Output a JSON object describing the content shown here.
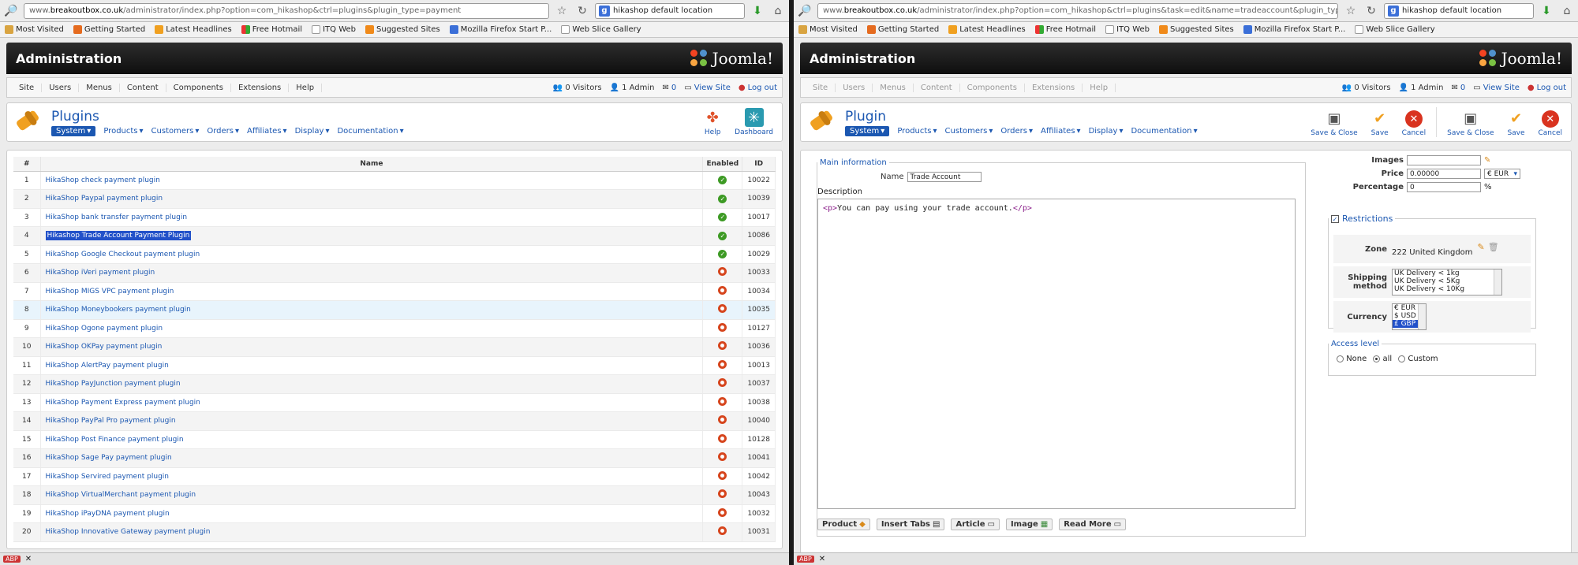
{
  "left": {
    "url_prefix": "www.",
    "url_host": "breakoutbox.co.uk",
    "url_path": "/administrator/index.php?option=com_hikashop&ctrl=plugins&plugin_type=payment",
    "search_text": "hikashop default location",
    "bookmarks": [
      "Most Visited",
      "Getting Started",
      "Latest Headlines",
      "Free Hotmail",
      "ITQ Web",
      "Suggested Sites",
      "Mozilla Firefox Start P...",
      "Web Slice Gallery"
    ],
    "admin_title": "Administration",
    "joomla_text": "Joomla!",
    "menu": [
      "Site",
      "Users",
      "Menus",
      "Content",
      "Components",
      "Extensions",
      "Help"
    ],
    "status": {
      "visitors": "0 Visitors",
      "admin": "1 Admin",
      "messages": "0",
      "view_site": "View Site",
      "logout": "Log out"
    },
    "page_title": "Plugins",
    "submenu": [
      "System",
      "Products",
      "Customers",
      "Orders",
      "Affiliates",
      "Display",
      "Documentation"
    ],
    "toolbar": {
      "help": "Help",
      "dashboard": "Dashboard"
    },
    "columns": {
      "num": "#",
      "name": "Name",
      "enabled": "Enabled",
      "id": "ID"
    },
    "rows": [
      {
        "n": "1",
        "name": "HikaShop check payment plugin",
        "enabled": true,
        "id": "10022"
      },
      {
        "n": "2",
        "name": "HikaShop Paypal payment plugin",
        "enabled": true,
        "id": "10039"
      },
      {
        "n": "3",
        "name": "HikaShop bank transfer payment plugin",
        "enabled": true,
        "id": "10017"
      },
      {
        "n": "4",
        "name": "Hikashop Trade Account Payment Plugin",
        "enabled": true,
        "id": "10086"
      },
      {
        "n": "5",
        "name": "HikaShop Google Checkout payment plugin",
        "enabled": true,
        "id": "10029"
      },
      {
        "n": "6",
        "name": "HikaShop iVeri payment plugin",
        "enabled": false,
        "id": "10033"
      },
      {
        "n": "7",
        "name": "HikaShop MIGS VPC payment plugin",
        "enabled": false,
        "id": "10034"
      },
      {
        "n": "8",
        "name": "HikaShop Moneybookers payment plugin",
        "enabled": false,
        "id": "10035"
      },
      {
        "n": "9",
        "name": "HikaShop Ogone payment plugin",
        "enabled": false,
        "id": "10127"
      },
      {
        "n": "10",
        "name": "HikaShop OKPay payment plugin",
        "enabled": false,
        "id": "10036"
      },
      {
        "n": "11",
        "name": "HikaShop AlertPay payment plugin",
        "enabled": false,
        "id": "10013"
      },
      {
        "n": "12",
        "name": "HikaShop PayJunction payment plugin",
        "enabled": false,
        "id": "10037"
      },
      {
        "n": "13",
        "name": "HikaShop Payment Express payment plugin",
        "enabled": false,
        "id": "10038"
      },
      {
        "n": "14",
        "name": "HikaShop PayPal Pro payment plugin",
        "enabled": false,
        "id": "10040"
      },
      {
        "n": "15",
        "name": "HikaShop Post Finance payment plugin",
        "enabled": false,
        "id": "10128"
      },
      {
        "n": "16",
        "name": "HikaShop Sage Pay payment plugin",
        "enabled": false,
        "id": "10041"
      },
      {
        "n": "17",
        "name": "HikaShop Servired payment plugin",
        "enabled": false,
        "id": "10042"
      },
      {
        "n": "18",
        "name": "HikaShop VirtualMerchant payment plugin",
        "enabled": false,
        "id": "10043"
      },
      {
        "n": "19",
        "name": "HikaShop iPayDNA payment plugin",
        "enabled": false,
        "id": "10032"
      },
      {
        "n": "20",
        "name": "HikaShop Innovative Gateway payment plugin",
        "enabled": false,
        "id": "10031"
      }
    ]
  },
  "right": {
    "url_prefix": "www.",
    "url_host": "breakoutbox.co.uk",
    "url_path": "/administrator/index.php?option=com_hikashop&ctrl=plugins&task=edit&name=tradeaccount&plugin_type=payment",
    "search_text": "hikashop default location",
    "bookmarks": [
      "Most Visited",
      "Getting Started",
      "Latest Headlines",
      "Free Hotmail",
      "ITQ Web",
      "Suggested Sites",
      "Mozilla Firefox Start P...",
      "Web Slice Gallery"
    ],
    "admin_title": "Administration",
    "joomla_text": "Joomla!",
    "menu": [
      "Site",
      "Users",
      "Menus",
      "Content",
      "Components",
      "Extensions",
      "Help"
    ],
    "status": {
      "visitors": "0 Visitors",
      "admin": "1 Admin",
      "messages": "0",
      "view_site": "View Site",
      "logout": "Log out"
    },
    "page_title": "Plugin",
    "submenu": [
      "System",
      "Products",
      "Customers",
      "Orders",
      "Affiliates",
      "Display",
      "Documentation"
    ],
    "toolbar": {
      "save_close": "Save & Close",
      "save": "Save",
      "cancel": "Cancel"
    },
    "main_info_legend": "Main information",
    "name_label": "Name",
    "name_value": "Trade Account",
    "description_label": "Description",
    "description_text": "You can pay using your trade account.",
    "editor_buttons": [
      "Product",
      "Insert Tabs",
      "Article",
      "Image",
      "Read More"
    ],
    "images_label": "Images",
    "price_label": "Price",
    "price_value": "0.00000",
    "currency_value": "€ EUR",
    "percentage_label": "Percentage",
    "percentage_value": "0",
    "percent_sign": "%",
    "restrictions_legend": "Restrictions",
    "zone_label": "Zone",
    "zone_value": "222 United Kingdom",
    "shipping_label": "Shipping method",
    "shipping_options": [
      "UK Delivery < 1kg",
      "UK Delivery < 5Kg",
      "UK Delivery < 10Kg"
    ],
    "currency_label": "Currency",
    "currency_options": [
      "€ EUR",
      "$ USD",
      "£ GBP"
    ],
    "access_legend": "Access level",
    "access_options": [
      "None",
      "all",
      "Custom"
    ]
  },
  "colors": {
    "link": "#1b57b1",
    "header_dark": "#0e0e0e",
    "enabled_green": "#3d9a24",
    "disabled_red": "#d6451d",
    "selection": "#2251c9"
  }
}
